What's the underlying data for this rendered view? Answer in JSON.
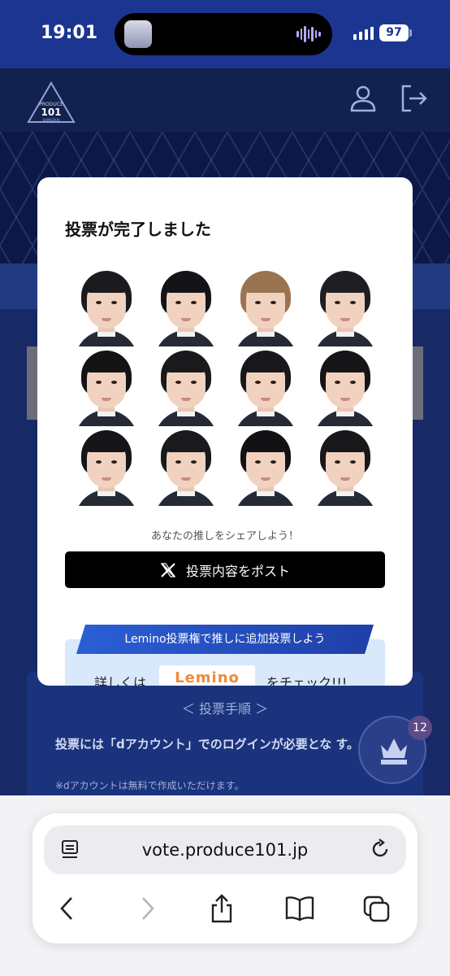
{
  "status_bar": {
    "time": "19:01",
    "battery": "97"
  },
  "site": {
    "logo_text": "PRODUCE 101",
    "logo_sub": "新世界 SHINSEKAI"
  },
  "background": {
    "steps_heading": "＜ 投票手順 ＞",
    "steps_body": "投票には「dアカウント」でのログインが必要とな す。",
    "steps_note": "※dアカウントは無料で作成いただけます。",
    "badge_count": "12"
  },
  "modal": {
    "title": "投票が完了しました",
    "share_text": "あなたの推しをシェアしよう！",
    "post_label": "投票内容をポスト",
    "lemino_ribbon": "Lemino投票権で推しに追加投票しよう",
    "lemino_pre": "詳しくは",
    "lemino_logo": "Lemino",
    "lemino_post": "をチェック!!!"
  },
  "trainees": [
    {
      "hair": "#1b1b1f"
    },
    {
      "hair": "#141418"
    },
    {
      "hair": "#9a7351"
    },
    {
      "hair": "#1e1e22"
    },
    {
      "hair": "#141416"
    },
    {
      "hair": "#1a1a1d"
    },
    {
      "hair": "#18181c"
    },
    {
      "hair": "#151518"
    },
    {
      "hair": "#16161a"
    },
    {
      "hair": "#1a1a1e"
    },
    {
      "hair": "#121215"
    },
    {
      "hair": "#18181b"
    }
  ],
  "browser": {
    "url": "vote.produce101.jp"
  },
  "colors": {
    "accent": "#1c3590",
    "lemino": "#f08a3a"
  }
}
